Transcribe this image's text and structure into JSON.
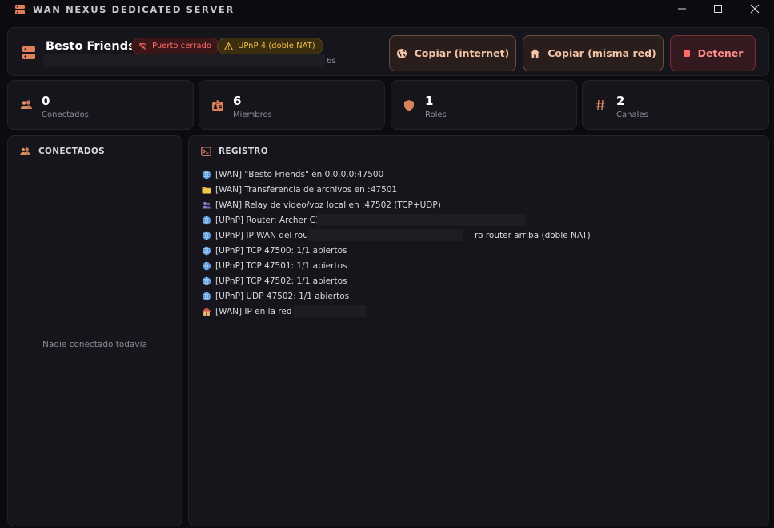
{
  "window": {
    "title": "WAN NEXUS DEDICATED SERVER",
    "accent": "#e0805a"
  },
  "header": {
    "server_name": "Besto Friends",
    "badge_port": "Puerto cerrado",
    "badge_upnp": "UPnP 4 (doble NAT)",
    "uptime": "6s",
    "btn_internet": "Copiar (internet)",
    "btn_local": "Copiar (misma red)",
    "btn_stop": "Detener"
  },
  "stats": [
    {
      "value": "0",
      "label": "Conectados",
      "icon": "users-icon"
    },
    {
      "value": "6",
      "label": "Miembros",
      "icon": "id-badge-icon"
    },
    {
      "value": "1",
      "label": "Roles",
      "icon": "shield-icon"
    },
    {
      "value": "2",
      "label": "Canales",
      "icon": "hash-icon"
    }
  ],
  "connected": {
    "title": "CONECTADOS",
    "empty": "Nadie conectado todavía"
  },
  "log": {
    "title": "REGISTRO",
    "entries": [
      {
        "icon": "globe-icon",
        "text": "[WAN] \"Besto Friends\" en 0.0.0.0:47500"
      },
      {
        "icon": "folder-icon",
        "text": "[WAN] Transferencia de archivos en :47501"
      },
      {
        "icon": "people-icon",
        "text": "[WAN] Relay de video/voz local en :47502 (TCP+UDP)"
      },
      {
        "icon": "globe-icon",
        "text": "[UPnP] Router: Archer C120("
      },
      {
        "icon": "globe-icon",
        "text": "[UPnP] IP WAN del router:",
        "suffix": "ro router arriba (doble NAT)"
      },
      {
        "icon": "globe-icon",
        "text": "[UPnP] TCP 47500: 1/1 abiertos"
      },
      {
        "icon": "globe-icon",
        "text": "[UPnP] TCP 47501: 1/1 abiertos"
      },
      {
        "icon": "globe-icon",
        "text": "[UPnP] TCP 47502: 1/1 abiertos"
      },
      {
        "icon": "globe-icon",
        "text": "[UPnP] UDP 47502: 1/1 abiertos"
      },
      {
        "icon": "home-icon",
        "text": "[WAN] IP en la red loca"
      }
    ]
  }
}
